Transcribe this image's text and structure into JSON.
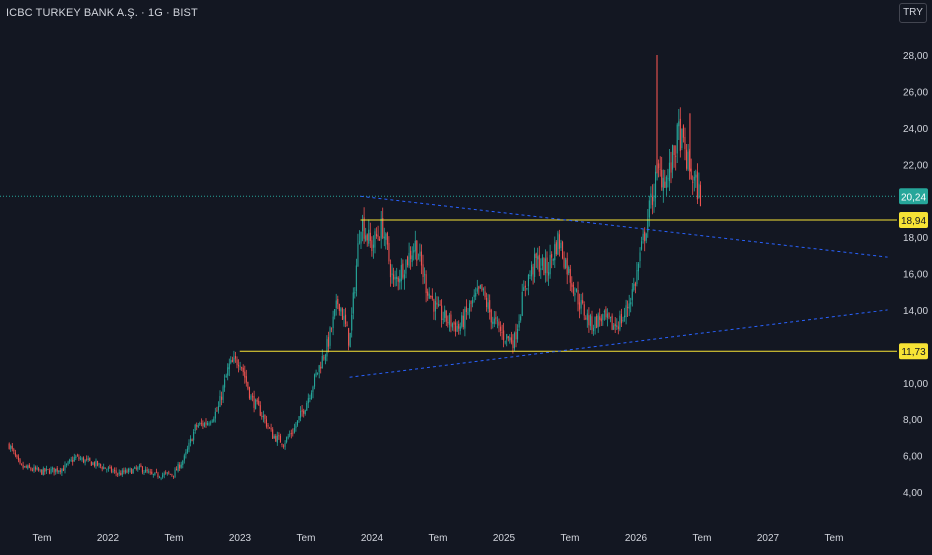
{
  "header": {
    "title": "ICBC TURKEY BANK A.Ş. · 1G · BIST",
    "currency_button": "TRY"
  },
  "colors": {
    "background": "#131722",
    "axis_text": "#d1d4dc",
    "candle_up": "#26a69a",
    "candle_down": "#ef5350",
    "horizontal_level": "#f7e335",
    "trendline": "#2962ff",
    "last_price_label": "#26a69a",
    "level_label_bg": "#f7e335"
  },
  "chart_data": {
    "type": "candlestick",
    "grid": false,
    "x_tick_labels": [
      "Tem",
      "2022",
      "Tem",
      "2023",
      "Tem",
      "2024",
      "Tem",
      "2025",
      "Tem",
      "2026",
      "Tem",
      "2027",
      "Tem"
    ],
    "y_axis": {
      "ticks": [
        4,
        6,
        8,
        10,
        12,
        14,
        16,
        18,
        22,
        24,
        26,
        28
      ],
      "tick_labels": [
        "4,00",
        "6,00",
        "8,00",
        "10,00",
        "12,00",
        "14,00",
        "16,00",
        "18,00",
        "22,00",
        "24,00",
        "26,00",
        "28,00"
      ],
      "ylim": [
        3.0,
        29.6
      ]
    },
    "price_path": [
      [
        "2021-04",
        6.6
      ],
      [
        "2021-05",
        5.4
      ],
      [
        "2021-07",
        5.1
      ],
      [
        "2021-09",
        5.3
      ],
      [
        "2021-10",
        5.9
      ],
      [
        "2021-12",
        5.5
      ],
      [
        "2022-02",
        5.0
      ],
      [
        "2022-04",
        5.3
      ],
      [
        "2022-05",
        4.9
      ],
      [
        "2022-07",
        5.0
      ],
      [
        "2022-08",
        5.9
      ],
      [
        "2022-09",
        7.6
      ],
      [
        "2022-10",
        7.8
      ],
      [
        "2022-11",
        8.5
      ],
      [
        "2022-12",
        10.9
      ],
      [
        "2023-01",
        11.3
      ],
      [
        "2023-02",
        9.2
      ],
      [
        "2023-03",
        8.3
      ],
      [
        "2023-04",
        7.1
      ],
      [
        "2023-05",
        6.7
      ],
      [
        "2023-06",
        7.5
      ],
      [
        "2023-07",
        8.8
      ],
      [
        "2023-08",
        10.5
      ],
      [
        "2023-09",
        12.1
      ],
      [
        "2023-10",
        14.6
      ],
      [
        "2023-11",
        12.2
      ],
      [
        "2023-12",
        19.0
      ],
      [
        "2024-01",
        17.5
      ],
      [
        "2024-02",
        18.6
      ],
      [
        "2024-03",
        15.4
      ],
      [
        "2024-04",
        16.5
      ],
      [
        "2024-05",
        17.6
      ],
      [
        "2024-06",
        15.3
      ],
      [
        "2024-07",
        13.9
      ],
      [
        "2024-08",
        13.4
      ],
      [
        "2024-09",
        13.0
      ],
      [
        "2024-10",
        14.2
      ],
      [
        "2024-11",
        15.1
      ],
      [
        "2024-12",
        13.5
      ],
      [
        "2025-01",
        12.6
      ],
      [
        "2025-02",
        12.3
      ],
      [
        "2025-03",
        15.4
      ],
      [
        "2025-04",
        16.7
      ],
      [
        "2025-05",
        16.2
      ],
      [
        "2025-06",
        17.9
      ],
      [
        "2025-07",
        16.0
      ],
      [
        "2025-08",
        14.3
      ],
      [
        "2025-09",
        13.2
      ],
      [
        "2025-10",
        13.6
      ],
      [
        "2025-11",
        13.1
      ],
      [
        "2025-12",
        13.6
      ],
      [
        "2026-01",
        15.5
      ],
      [
        "2026-02",
        18.6
      ],
      [
        "2026-03",
        21.5
      ],
      [
        "2026-04",
        21.2
      ],
      [
        "2026-05",
        23.8
      ],
      [
        "2026-06",
        21.6
      ],
      [
        "2026-07",
        20.2
      ]
    ],
    "spikes": [
      {
        "date": "2026-03",
        "high": 28.0
      },
      {
        "date": "2026-06",
        "high": 24.8
      }
    ],
    "horizontal_levels": [
      {
        "price": 18.94,
        "from": "2023-12"
      },
      {
        "price": 11.73,
        "from": "2023-01"
      }
    ],
    "trendlines": [
      {
        "from": [
          "2023-12",
          20.24
        ],
        "to": [
          "2027-12",
          16.9
        ]
      },
      {
        "from": [
          "2023-11",
          10.3
        ],
        "to": [
          "2027-12",
          14.0
        ]
      }
    ],
    "last_price": {
      "value": 20.24,
      "label": "20,24"
    },
    "price_labels": [
      {
        "value": 18.94,
        "label": "18,94"
      },
      {
        "value": 11.73,
        "label": "11,73"
      }
    ]
  }
}
